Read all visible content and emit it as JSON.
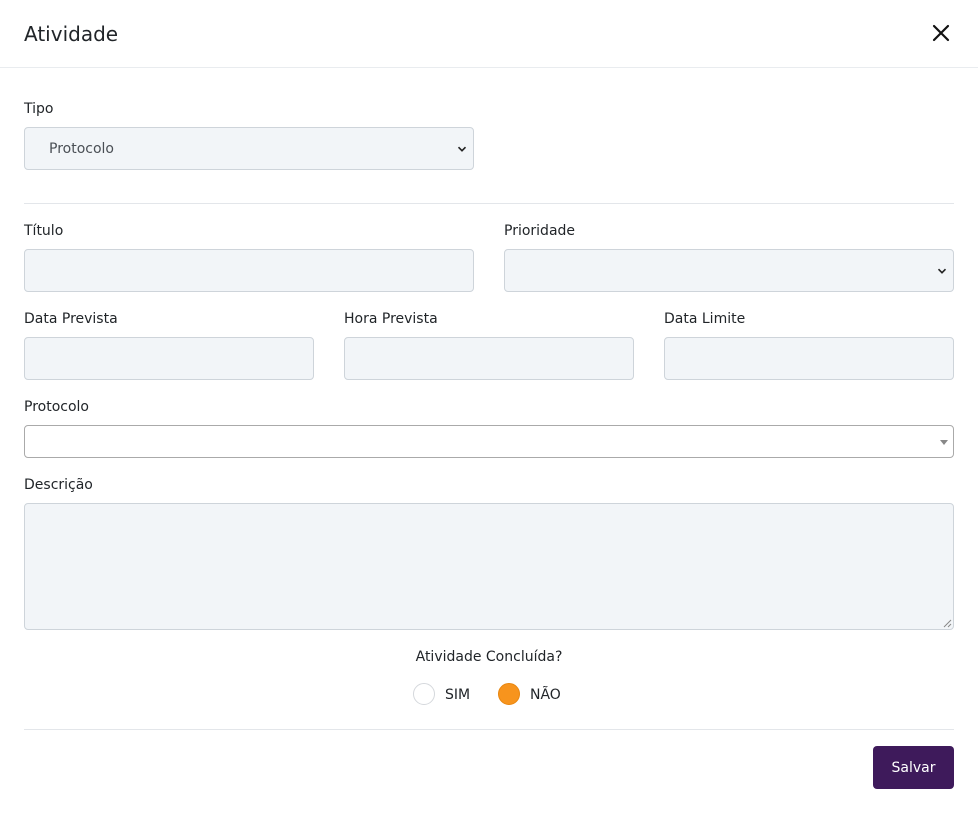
{
  "modal": {
    "title": "Atividade"
  },
  "form": {
    "tipo": {
      "label": "Tipo",
      "selected": "Protocolo"
    },
    "titulo": {
      "label": "Título",
      "value": ""
    },
    "prioridade": {
      "label": "Prioridade",
      "selected": ""
    },
    "data_prevista": {
      "label": "Data Prevista",
      "value": ""
    },
    "hora_prevista": {
      "label": "Hora Prevista",
      "value": ""
    },
    "data_limite": {
      "label": "Data Limite",
      "value": ""
    },
    "protocolo": {
      "label": "Protocolo",
      "selected": ""
    },
    "descricao": {
      "label": "Descrição",
      "value": ""
    },
    "concluida": {
      "label": "Atividade Concluída?",
      "options": [
        "SIM",
        "NÃO"
      ],
      "selected": "NÃO"
    }
  },
  "footer": {
    "save_label": "Salvar"
  },
  "colors": {
    "primary_button": "#3e1a5b",
    "radio_selected": "#f7941d",
    "field_background": "#f2f5f8"
  }
}
